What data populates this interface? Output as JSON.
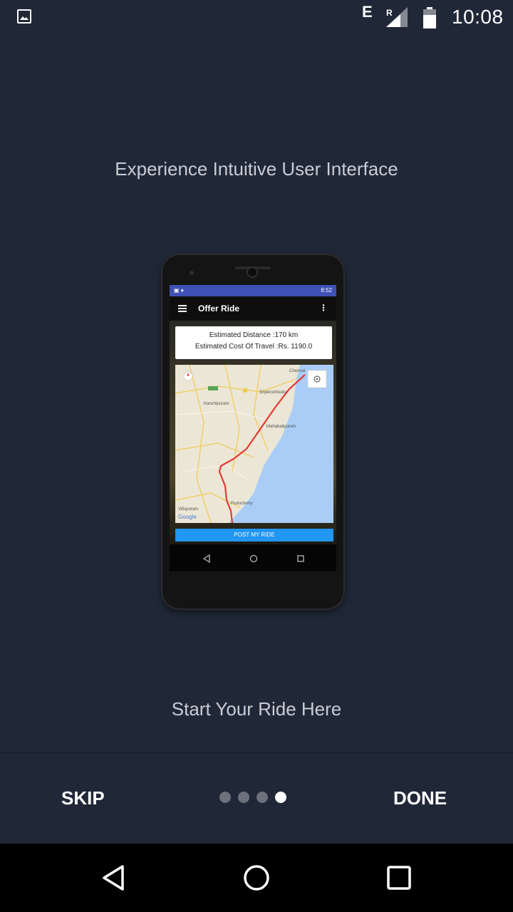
{
  "status_bar": {
    "network_type": "E",
    "roaming": "R",
    "time": "10:08"
  },
  "headline": "Experience Intuitive User Interface",
  "phone_mockup": {
    "status_time": "8:52",
    "toolbar_title": "Offer Ride",
    "estimated_distance": "Estimated Distance :170 km",
    "estimated_cost": "Estimated Cost Of Travel :Rs. 1190.0",
    "map_labels": [
      "Chennai",
      "Kanchipuram",
      "Sriperumbudur",
      "Mahabalipuram",
      "Puducherry",
      "Villupuram",
      "Google"
    ],
    "post_button": "POST MY RIDE"
  },
  "caption": "Start Your Ride Here",
  "bottom_bar": {
    "skip_label": "SKIP",
    "done_label": "DONE",
    "page_count": 4,
    "current_page": 4
  },
  "system_nav": {
    "icons": [
      "back-icon",
      "home-icon",
      "recents-icon"
    ]
  },
  "colors": {
    "background": "#202838",
    "text_muted": "#c8ccd4",
    "dot_inactive": "#6c717c",
    "dot_active": "#ffffff",
    "phone_toolbar": "#3f51b5",
    "post_button": "#2196f3"
  }
}
